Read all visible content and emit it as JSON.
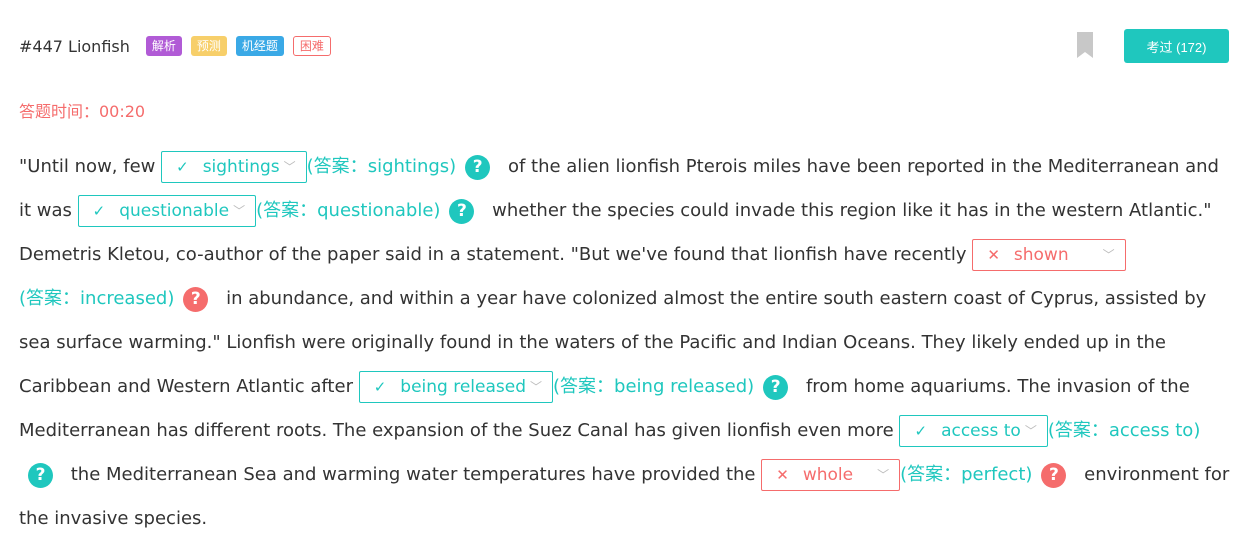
{
  "header": {
    "title": "#447 Lionfish",
    "tags": [
      {
        "label": "解析",
        "color": "#b15bd6"
      },
      {
        "label": "预测",
        "color": "#f7cf6a"
      },
      {
        "label": "机经题",
        "color": "#3aa9e6"
      },
      {
        "label": "困难",
        "color": "#f56c6c"
      }
    ],
    "exam_button": "考过 (172)"
  },
  "timer": "答题时间：00:20",
  "passage": {
    "answer_prefix": "(答案：",
    "answer_suffix": ")",
    "t0": "\"Until now, few",
    "t1": "of the alien lionfish Pterois miles have been reported in the Mediterranean and it was",
    "t2": "whether the species could invade this region like it has in the western Atlantic.\" Demetris Kletou, co-author of the paper said in a statement. \"But we've found that lionfish have recently",
    "t3": "in abundance, and within a year have colonized almost the entire south eastern coast of Cyprus, assisted by sea surface warming.\" Lionfish were originally found in the waters of the Pacific and Indian Oceans. They likely ended up in the Caribbean and Western Atlantic after",
    "t4": "from home aquariums. The invasion of the Mediterranean has different roots. The expansion of the Suez Canal has given lionfish even more",
    "t5": "the Mediterranean Sea and warming water temperatures have provided the",
    "t6": "environment for the invasive species.",
    "blanks": [
      {
        "selected": "sightings",
        "answer": "sightings",
        "status_icon": "✓"
      },
      {
        "selected": "questionable",
        "answer": "questionable",
        "status_icon": "✓"
      },
      {
        "selected": "shown",
        "answer": "increased",
        "status_icon": "✕"
      },
      {
        "selected": "being released",
        "answer": "being released",
        "status_icon": "✓"
      },
      {
        "selected": "access to",
        "answer": "access to",
        "status_icon": "✓"
      },
      {
        "selected": "whole",
        "answer": "perfect",
        "status_icon": "✕"
      }
    ],
    "help_glyph": "?",
    "chevron_glyph": "﹀"
  },
  "colors": {
    "correct": "#1fc7be",
    "wrong": "#f56c6c",
    "timer": "#f56c6c",
    "button": "#1fc7be"
  }
}
